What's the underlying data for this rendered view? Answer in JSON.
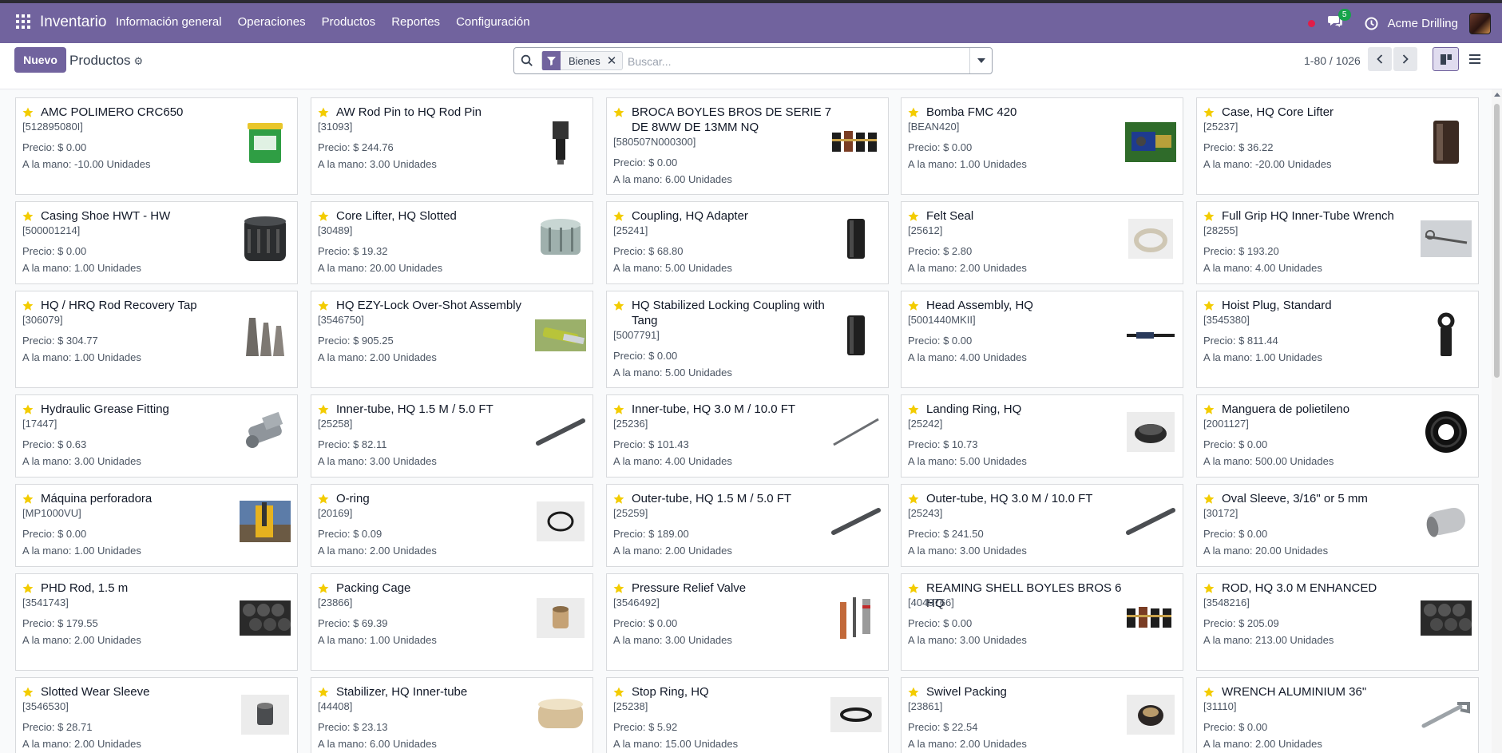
{
  "navbar": {
    "app_name": "Inventario",
    "menu": [
      "Información general",
      "Operaciones",
      "Productos",
      "Reportes",
      "Configuración"
    ],
    "messages_count": "5",
    "company": "Acme Drilling"
  },
  "control_panel": {
    "new_label": "Nuevo",
    "title": "Productos",
    "facet_label": "Bienes",
    "search_placeholder": "Buscar...",
    "pager_text": "1-80 / 1026"
  },
  "card_labels": {
    "price_prefix": "Precio: ",
    "qty_prefix": "A la mano: "
  },
  "products": [
    {
      "name": "AMC POLIMERO CRC650",
      "ref": "[512895080I]",
      "price": "$ 0.00",
      "qty": "-10.00 Unidades",
      "icon": "green-bucket-image"
    },
    {
      "name": "AW Rod Pin to HQ Rod Pin",
      "ref": "[31093]",
      "price": "$ 244.76",
      "qty": "3.00 Unidades",
      "icon": "rod-pin-image"
    },
    {
      "name": "BROCA BOYLES BROS DE SERIE 7 DE 8WW DE 13MM NQ",
      "ref": "[580507N000300]",
      "price": "$ 0.00",
      "qty": "6.00 Unidades",
      "icon": "drill-bits-image"
    },
    {
      "name": "Bomba FMC 420",
      "ref": "[BEAN420]",
      "price": "$ 0.00",
      "qty": "1.00 Unidades",
      "icon": "pump-image"
    },
    {
      "name": "Case, HQ Core Lifter",
      "ref": "[25237]",
      "price": "$ 36.22",
      "qty": "-20.00 Unidades",
      "icon": "core-case-image"
    },
    {
      "name": "Casing Shoe HWT - HW",
      "ref": "[500001214]",
      "price": "$ 0.00",
      "qty": "1.00 Unidades",
      "icon": "casing-shoe-image"
    },
    {
      "name": "Core Lifter, HQ Slotted",
      "ref": "[30489]",
      "price": "$ 19.32",
      "qty": "20.00 Unidades",
      "icon": "core-lifter-image"
    },
    {
      "name": "Coupling, HQ Adapter",
      "ref": "[25241]",
      "price": "$ 68.80",
      "qty": "5.00 Unidades",
      "icon": "coupling-image"
    },
    {
      "name": "Felt Seal",
      "ref": "[25612]",
      "price": "$ 2.80",
      "qty": "2.00 Unidades",
      "icon": "felt-seal-image"
    },
    {
      "name": "Full Grip HQ Inner-Tube Wrench",
      "ref": "[28255]",
      "price": "$ 193.20",
      "qty": "4.00 Unidades",
      "icon": "wrench-image"
    },
    {
      "name": "HQ / HRQ Rod Recovery Tap",
      "ref": "[306079]",
      "price": "$ 304.77",
      "qty": "1.00 Unidades",
      "icon": "recovery-tap-image"
    },
    {
      "name": "HQ EZY-Lock Over-Shot Assembly",
      "ref": "[3546750]",
      "price": "$ 905.25",
      "qty": "2.00 Unidades",
      "icon": "overshot-image"
    },
    {
      "name": "HQ Stabilized Locking Coupling with Tang",
      "ref": "[5007791]",
      "price": "$ 0.00",
      "qty": "5.00 Unidades",
      "icon": "coupling-image"
    },
    {
      "name": "Head Assembly, HQ",
      "ref": "[5001440MKII]",
      "price": "$ 0.00",
      "qty": "4.00 Unidades",
      "icon": "head-assembly-image"
    },
    {
      "name": "Hoist Plug, Standard",
      "ref": "[3545380]",
      "price": "$ 811.44",
      "qty": "1.00 Unidades",
      "icon": "hoist-plug-image"
    },
    {
      "name": "Hydraulic Grease Fitting",
      "ref": "[17447]",
      "price": "$ 0.63",
      "qty": "3.00 Unidades",
      "icon": "grease-fitting-image"
    },
    {
      "name": "Inner-tube, HQ 1.5 M / 5.0 FT",
      "ref": "[25258]",
      "price": "$ 82.11",
      "qty": "3.00 Unidades",
      "icon": "tube-image"
    },
    {
      "name": "Inner-tube, HQ 3.0 M / 10.0 FT",
      "ref": "[25236]",
      "price": "$ 101.43",
      "qty": "4.00 Unidades",
      "icon": "thin-tube-image"
    },
    {
      "name": "Landing Ring, HQ",
      "ref": "[25242]",
      "price": "$ 10.73",
      "qty": "5.00 Unidades",
      "icon": "ring-image"
    },
    {
      "name": "Manguera de polietileno",
      "ref": "[2001127]",
      "price": "$ 0.00",
      "qty": "500.00 Unidades",
      "icon": "hose-image"
    },
    {
      "name": "Máquina perforadora",
      "ref": "[MP1000VU]",
      "price": "$ 0.00",
      "qty": "1.00 Unidades",
      "icon": "drilling-machine-image"
    },
    {
      "name": "O-ring",
      "ref": "[20169]",
      "price": "$ 0.09",
      "qty": "2.00 Unidades",
      "icon": "o-ring-image"
    },
    {
      "name": "Outer-tube, HQ 1.5 M / 5.0 FT",
      "ref": "[25259]",
      "price": "$ 189.00",
      "qty": "2.00 Unidades",
      "icon": "tube-image"
    },
    {
      "name": "Outer-tube, HQ 3.0 M / 10.0 FT",
      "ref": "[25243]",
      "price": "$ 241.50",
      "qty": "3.00 Unidades",
      "icon": "tube-image"
    },
    {
      "name": "Oval Sleeve, 3/16\" or 5 mm",
      "ref": "[30172]",
      "price": "$ 0.00",
      "qty": "20.00 Unidades",
      "icon": "oval-sleeve-image"
    },
    {
      "name": "PHD Rod, 1.5 m",
      "ref": "[3541743]",
      "price": "$ 179.55",
      "qty": "2.00 Unidades",
      "icon": "rods-pile-image"
    },
    {
      "name": "Packing Cage",
      "ref": "[23866]",
      "price": "$ 69.39",
      "qty": "1.00 Unidades",
      "icon": "packing-cage-image"
    },
    {
      "name": "Pressure Relief Valve",
      "ref": "[3546492]",
      "price": "$ 0.00",
      "qty": "3.00 Unidades",
      "icon": "valve-image"
    },
    {
      "name": "REAMING SHELL BOYLES BROS 6 HQ",
      "ref": "[4049766]",
      "price": "$ 0.00",
      "qty": "3.00 Unidades",
      "icon": "drill-bits-image"
    },
    {
      "name": "ROD, HQ 3.0 M ENHANCED",
      "ref": "[3548216]",
      "price": "$ 205.09",
      "qty": "213.00 Unidades",
      "icon": "rods-pile-image"
    },
    {
      "name": "Slotted Wear Sleeve",
      "ref": "[3546530]",
      "price": "$ 28.71",
      "qty": "2.00 Unidades",
      "icon": "sleeve-image"
    },
    {
      "name": "Stabilizer, HQ Inner-tube",
      "ref": "[44408]",
      "price": "$ 23.13",
      "qty": "6.00 Unidades",
      "icon": "stabilizer-image"
    },
    {
      "name": "Stop Ring, HQ",
      "ref": "[25238]",
      "price": "$ 5.92",
      "qty": "15.00 Unidades",
      "icon": "stop-ring-image"
    },
    {
      "name": "Swivel Packing",
      "ref": "[23861]",
      "price": "$ 22.54",
      "qty": "2.00 Unidades",
      "icon": "swivel-packing-image"
    },
    {
      "name": "WRENCH ALUMINIUM 36\"",
      "ref": "[31110]",
      "price": "$ 0.00",
      "qty": "2.00 Unidades",
      "icon": "pipe-wrench-image"
    }
  ]
}
